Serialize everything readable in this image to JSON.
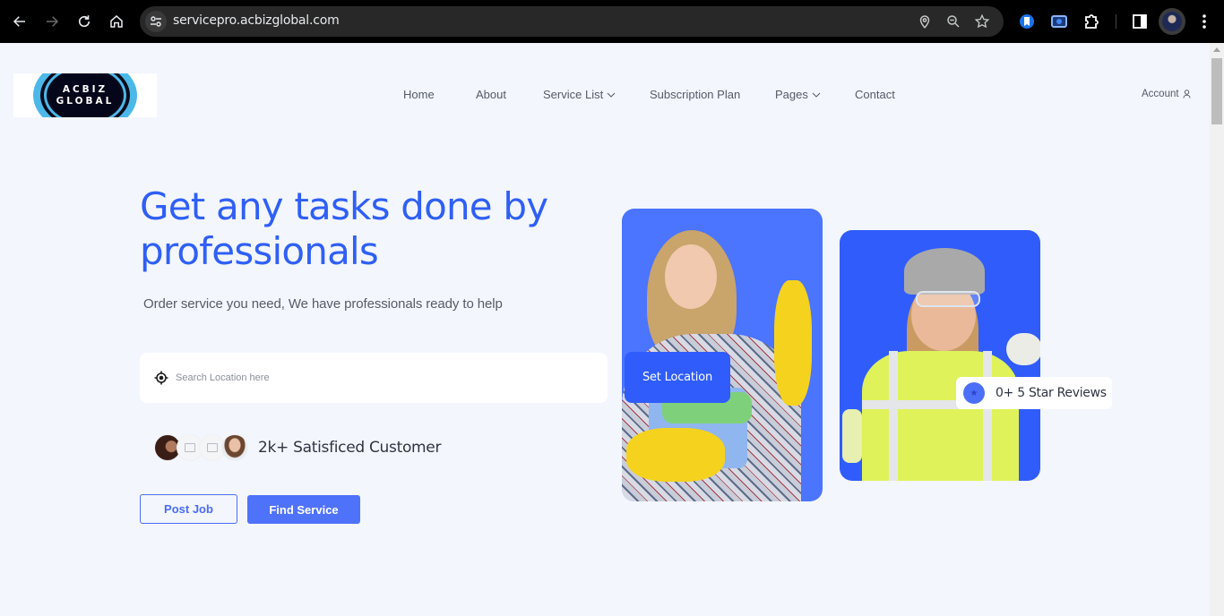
{
  "browser": {
    "url": "servicepro.acbizglobal.com",
    "icons": {
      "back": "arrow-left-icon",
      "forward": "arrow-right-icon",
      "reload": "reload-icon",
      "home": "home-icon",
      "site_info": "tune-icon",
      "location": "location-pin-icon",
      "zoom": "zoom-out-icon",
      "bookmark": "star-icon",
      "extensions": [
        "bookmark-extension-icon",
        "screen-capture-extension-icon",
        "puzzle-icon"
      ],
      "side_panel": "side-panel-icon",
      "profile": "profile-avatar",
      "menu": "kebab-menu-icon"
    }
  },
  "header": {
    "logo": {
      "line1": "ACBIZ",
      "line2": "GLOBAL"
    },
    "nav": [
      {
        "label": "Home",
        "has_dropdown": false
      },
      {
        "label": "About",
        "has_dropdown": false
      },
      {
        "label": "Service List",
        "has_dropdown": true
      },
      {
        "label": "Subscription Plan",
        "has_dropdown": false
      },
      {
        "label": "Pages",
        "has_dropdown": true
      },
      {
        "label": "Contact",
        "has_dropdown": false
      }
    ],
    "account_label": "Account"
  },
  "hero": {
    "title": "Get any tasks done by professionals",
    "subtitle": "Order service you need, We have professionals ready to help",
    "search": {
      "placeholder": "Search Location here",
      "value": ""
    },
    "customers_text": "2k+ Satisficed Customer",
    "post_job_label": "Post Job",
    "find_service_label": "Find Service",
    "set_location_label": "Set Location",
    "reviews_text": "0+ 5 Star Reviews"
  },
  "colors": {
    "accent": "#2f5ff5",
    "button": "#4f72fa",
    "card_light": "#4b74ff",
    "card_dark": "#2f5cfb",
    "page_bg": "#f3f6fd"
  }
}
